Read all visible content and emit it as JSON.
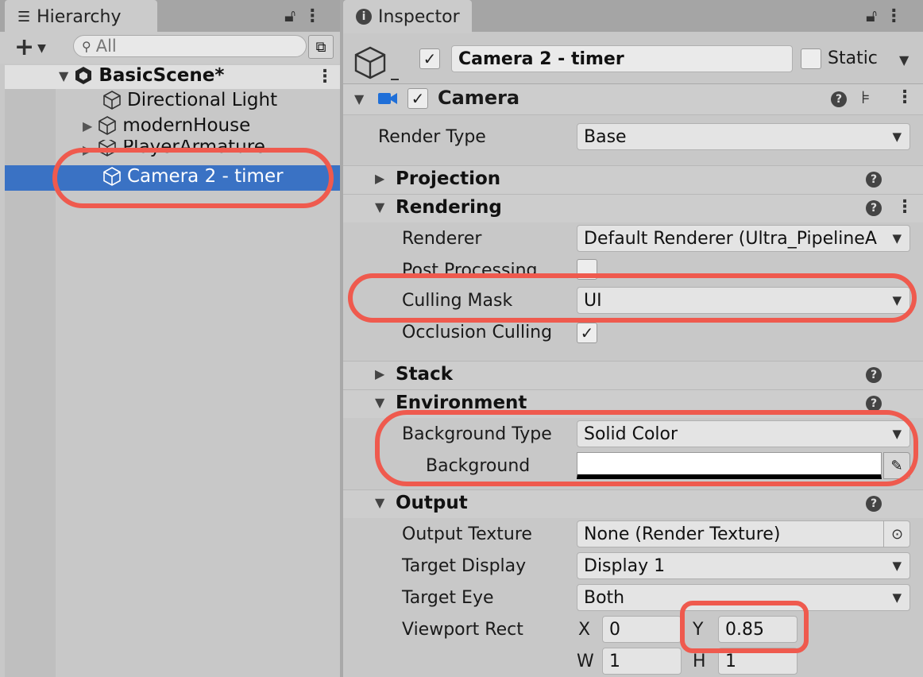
{
  "hierarchy": {
    "tab_title": "Hierarchy",
    "search_placeholder": "All",
    "add_button": "+",
    "scene": "BasicScene*",
    "items": [
      {
        "label": "Directional Light"
      },
      {
        "label": "modernHouse"
      },
      {
        "label": "PlayerArmature"
      },
      {
        "label": "Camera 2 - timer"
      }
    ]
  },
  "inspector": {
    "tab_title": "Inspector",
    "object_name": "Camera 2 - timer",
    "static_label": "Static",
    "component_title": "Camera",
    "render_type_label": "Render Type",
    "render_type_value": "Base",
    "sections": {
      "projection": "Projection",
      "rendering": "Rendering",
      "stack": "Stack",
      "environment": "Environment",
      "output": "Output"
    },
    "rendering": {
      "renderer_label": "Renderer",
      "renderer_value": "Default Renderer (Ultra_PipelineA",
      "post_processing_label": "Post Processing",
      "culling_mask_label": "Culling Mask",
      "culling_mask_value": "UI",
      "occlusion_culling_label": "Occlusion Culling"
    },
    "environment": {
      "background_type_label": "Background Type",
      "background_type_value": "Solid Color",
      "background_label": "Background",
      "background_color": "#ffffff"
    },
    "output": {
      "output_texture_label": "Output Texture",
      "output_texture_value": "None (Render Texture)",
      "target_display_label": "Target Display",
      "target_display_value": "Display 1",
      "target_eye_label": "Target Eye",
      "target_eye_value": "Both",
      "viewport_rect_label": "Viewport Rect",
      "x_label": "X",
      "x_value": "0",
      "y_label": "Y",
      "y_value": "0.85",
      "w_label": "W",
      "w_value": "1",
      "h_label": "H",
      "h_value": "1"
    }
  },
  "colors": {
    "selection": "#3a72c4",
    "callout": "#ef5a4e"
  }
}
